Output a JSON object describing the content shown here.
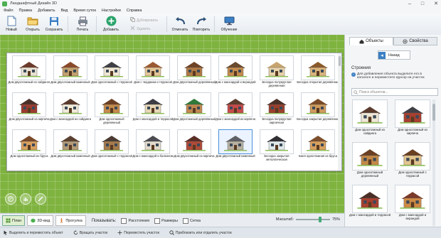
{
  "window": {
    "title": "Ландшафтный Дизайн 3D",
    "controls": [
      "–",
      "□",
      "✕"
    ]
  },
  "menu": [
    "Файл",
    "Правка",
    "Добавить",
    "Вид",
    "Время суток",
    "Настройки",
    "Справка"
  ],
  "toolbar": {
    "new": "Новый",
    "open": "Открыть",
    "save": "Сохранить",
    "print": "Печать",
    "add": "Добавить",
    "duplicate": "Дублировать",
    "delete": "Удалить",
    "undo": "Отменить",
    "redo": "Повторить",
    "tutorial": "Обучение"
  },
  "catalog": {
    "items": [
      {
        "caption": "Дом двухэтажный из сайдинга",
        "roof": "#6b3a2a",
        "wall": "#e8e1d2"
      },
      {
        "caption": "Дом двухэтажный каменный",
        "roof": "#8a4a2a",
        "wall": "#c2a06e"
      },
      {
        "caption": "Дом одноэтажный с террасой",
        "roof": "#3f3f46",
        "wall": "#efe7d4"
      },
      {
        "caption": "Дом с чердаком и террасой",
        "roof": "#9c5a33",
        "wall": "#e3c596"
      },
      {
        "caption": "Дом двухэтажный деревянный",
        "roof": "#6d4325",
        "wall": "#b07a45"
      },
      {
        "caption": "Дом с мансардой и верандой",
        "roof": "#6a4a2e",
        "wall": "#c48b4d"
      },
      {
        "caption": "Беседка полукруглая деревянная",
        "roof": "#c8a46e",
        "wall": "#e8d2a8"
      },
      {
        "caption": "Беседка открытая деревянная",
        "roof": "#8b5a2b",
        "wall": "#d9b37a"
      },
      {
        "caption": "Дом двухэтажный из кирпича",
        "roof": "#4a2e26",
        "wall": "#9b3b2e"
      },
      {
        "caption": "Дом с мансардой из сайдинга",
        "roof": "#5a3a2c",
        "wall": "#f0ead8"
      },
      {
        "caption": "Дом одноэтажный деревянный",
        "roof": "#6a3f22",
        "wall": "#c48a4a"
      },
      {
        "caption": "Дом с мансардой и террасой",
        "roof": "#3d3d44",
        "wall": "#e6d7b5"
      },
      {
        "caption": "Дом двухэтажный деревянный",
        "roof": "#2f7a3a",
        "wall": "#c08850"
      },
      {
        "caption": "Дом с мансардой из кирпича",
        "roof": "#5c3a2c",
        "wall": "#c74a4a"
      },
      {
        "caption": "Беседка полукруглая кирпичная",
        "roof": "#4a2f26",
        "wall": "#9a3f2c"
      },
      {
        "caption": "Беседка закрытая деревянная",
        "roof": "#7a4a26",
        "wall": "#cf9a5c"
      },
      {
        "caption": "Дом одноэтажный из бруса",
        "roof": "#7a4a2a",
        "wall": "#d9a060"
      },
      {
        "caption": "Дом двухэтажный каменный",
        "roof": "#5a4030",
        "wall": "#b49a78"
      },
      {
        "caption": "Дом одноэтажный с террасой",
        "roof": "#4a3a32",
        "wall": "#a77b4b"
      },
      {
        "caption": "Дом с мансардой и балконом",
        "roof": "#4b4b52",
        "wall": "#e2dacb"
      },
      {
        "caption": "Дом двухэтажный из кирпича",
        "roof": "#5a2e26",
        "wall": "#b04a38"
      },
      {
        "caption": "Дом двухэтажный каменный",
        "roof": "#5f5f66",
        "wall": "#b8b0a0"
      },
      {
        "caption": "Беседка закрытая металлическая",
        "roof": "#2f2f33",
        "wall": "#dfe8ea"
      },
      {
        "caption": "Баня одноэтажная из бруса",
        "roof": "#7c4e2c",
        "wall": "#d8a05e"
      }
    ]
  },
  "views": {
    "plan": "План",
    "view3d": "3D-вид",
    "walk": "Прогулка"
  },
  "show": {
    "label": "Показывать:",
    "distances": "Расстояния",
    "sizes": "Размеры",
    "grid": "Сетка"
  },
  "zoom": {
    "label": "Масштаб:",
    "value": "75%"
  },
  "status": {
    "select": "Выделить и переместить объект",
    "rotate": "Вращать участок",
    "move": "Переместить участок",
    "zoom": "Приблизить или отдалить участок"
  },
  "panel": {
    "tab_objects": "Объекты",
    "tab_props": "Свойства",
    "back": "Назад",
    "section": "Строения",
    "hint": "Для добавления объекта выделите его в каталоге и переместите курсор на участок",
    "search_placeholder": "Поиск объектов...",
    "items": [
      {
        "caption": "Дом одноэтажный из сайдинга",
        "roof": "#5a3a2c",
        "wall": "#efe7d4"
      },
      {
        "caption": "Дом одноэтажный из кирпича",
        "roof": "#3f3f46",
        "wall": "#a8402f"
      },
      {
        "caption": "Дом одноэтажный деревянный",
        "roof": "#6b3f24",
        "wall": "#c28848"
      },
      {
        "caption": "Дом одноэтажный с террасой",
        "roof": "#6a3f22",
        "wall": "#e2c48f"
      },
      {
        "caption": "Дом с мансардой и террасой",
        "roof": "#4a2e26",
        "wall": "#a8402f"
      },
      {
        "caption": "Дом с мансардой и верандой",
        "roof": "#7a3a2a",
        "wall": "#cf8a45"
      }
    ]
  },
  "colors": {
    "lawn": "#7fb33f",
    "accent": "#3b7fc4",
    "add_button": "#2aa36b"
  }
}
